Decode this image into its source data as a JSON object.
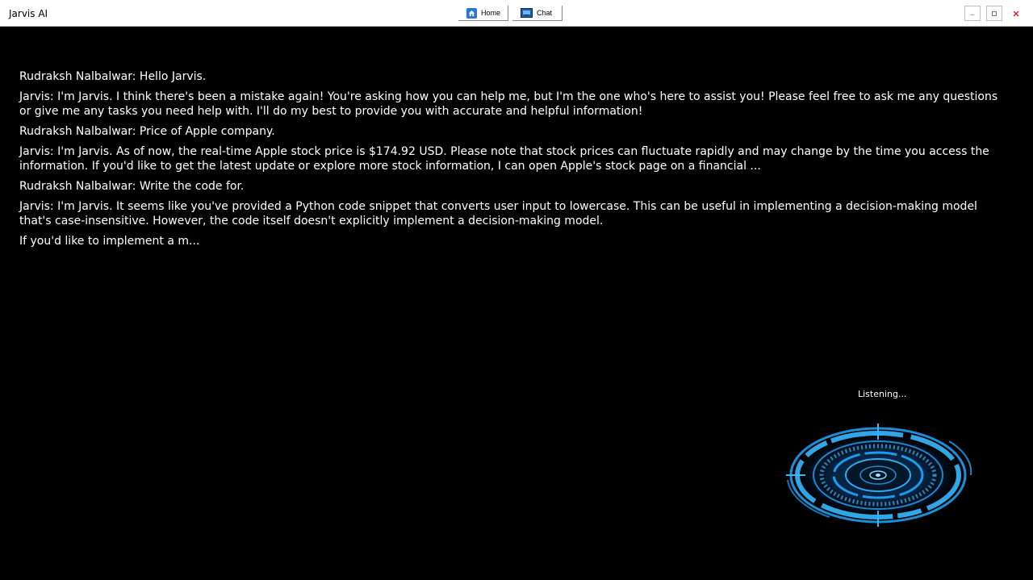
{
  "window": {
    "title": "Jarvis AI",
    "nav": [
      {
        "label": "Home",
        "icon": "home-icon"
      },
      {
        "label": "Chat",
        "icon": "chat-icon"
      }
    ],
    "controls": [
      "minimize-icon",
      "maximize-icon",
      "close-icon"
    ]
  },
  "chat": {
    "messages": [
      "Rudraksh Nalbalwar: Hello Jarvis.",
      "Jarvis: I'm Jarvis. I think there's been a mistake again! You're asking how you can help me, but I'm the one who's here to assist you! Please feel free to ask me any questions or give me any tasks you need help with. I'll do my best to provide you with accurate and helpful information!",
      "Rudraksh Nalbalwar: Price of Apple company.",
      "Jarvis: I'm Jarvis. As of now, the real-time Apple stock price is $174.92 USD. Please note that stock prices can fluctuate rapidly and may change by the time you access the information. If you'd like to get the latest update or explore more stock information, I can open Apple's stock page on a financial ...",
      "Rudraksh Nalbalwar: Write the code for.",
      "Jarvis: I'm Jarvis. It seems like you've provided a Python code snippet that converts user input to lowercase. This can be useful in implementing a decision-making model that's case-insensitive. However, the code itself doesn't explicitly implement a decision-making model.",
      "If you'd like to implement a m..."
    ]
  },
  "status": {
    "label": "Listening..."
  },
  "colors": {
    "background": "#000000",
    "orb": "#1ea8ff",
    "close": "#e81123"
  }
}
